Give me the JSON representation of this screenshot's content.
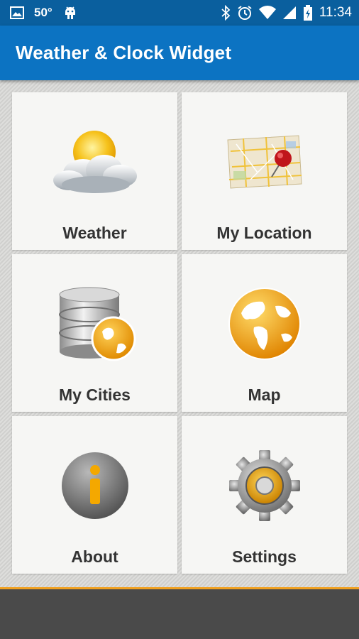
{
  "status_bar": {
    "temperature": "50°",
    "time": "11:34",
    "icons": [
      "image-icon",
      "android-icon",
      "bluetooth-icon",
      "alarm-icon",
      "wifi-icon",
      "signal-icon",
      "battery-icon"
    ]
  },
  "app_bar": {
    "title": "Weather & Clock Widget"
  },
  "grid": {
    "items": [
      {
        "label": "Weather",
        "icon": "weather-sun-cloud-icon"
      },
      {
        "label": "My Location",
        "icon": "map-pin-icon"
      },
      {
        "label": "My Cities",
        "icon": "database-globe-icon"
      },
      {
        "label": "Map",
        "icon": "globe-icon"
      },
      {
        "label": "About",
        "icon": "info-icon"
      },
      {
        "label": "Settings",
        "icon": "gear-icon"
      }
    ]
  },
  "colors": {
    "status_bar": "#0a5f9e",
    "app_bar": "#0c73c2",
    "tile": "#f6f6f4",
    "accent": "#f0a020",
    "bottom_bar": "#4a4a4a"
  }
}
